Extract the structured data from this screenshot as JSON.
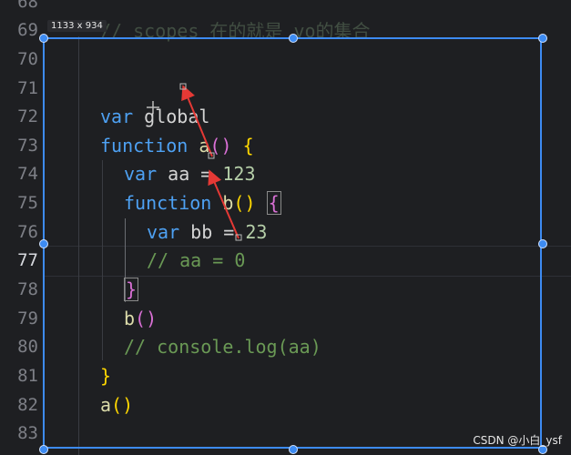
{
  "editor": {
    "line_numbers": [
      "68",
      "69",
      "70",
      "71",
      "72",
      "73",
      "74",
      "75",
      "76",
      "77",
      "78",
      "79",
      "80",
      "81",
      "82",
      "83"
    ],
    "active_line": "77",
    "top_comment": "// scopes 在的就是 vo的集合",
    "lines": {
      "l72": {
        "kw": "var",
        "id": " global"
      },
      "l73": {
        "kw": "function",
        "fn": " a",
        "br": "()",
        "sp": " ",
        "brace": "{"
      },
      "l74": {
        "kw": "var",
        "id": " aa = ",
        "num": "123"
      },
      "l75": {
        "kw": "function",
        "fn": " b",
        "br": "()",
        "sp": " ",
        "brace": "{"
      },
      "l76": {
        "kw": "var",
        "id": " bb = ",
        "num": "23"
      },
      "l77": {
        "cm": "// aa = 0"
      },
      "l78": {
        "brace": "}"
      },
      "l79": {
        "fn": "b",
        "br": "()"
      },
      "l80": {
        "cm": "// console.log(aa)"
      },
      "l81": {
        "brace": "}"
      },
      "l82": {
        "fn": "a",
        "br": "()"
      }
    }
  },
  "overlay": {
    "dimension_label": "1133 x 934",
    "selection_color": "#3d8bf2",
    "arrow_color": "#e53935"
  },
  "watermark": "CSDN @小白_ysf"
}
